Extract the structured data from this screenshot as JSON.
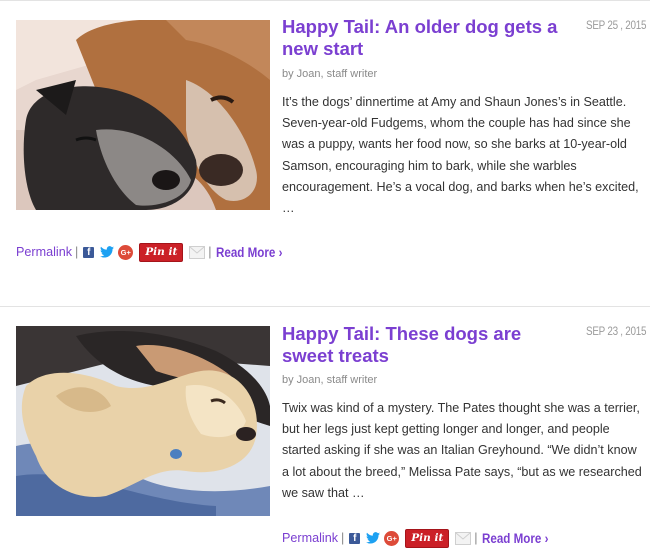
{
  "posts": [
    {
      "title": "Happy Tail: An older dog gets a new start",
      "date": "SEP 25 , 2015",
      "byline": "by Joan, staff writer",
      "excerpt": "It’s the dogs’ dinnertime at Amy and Shaun Jones’s in Seattle. Seven-year-old Fudgems, whom the couple has had since she was a puppy, wants her food now, so she barks at 10-year-old Samson, encouraging him to bark, while she warbles encouragement. He’s a vocal dog, and barks when he’s excited, …",
      "permalink_label": "Permalink",
      "pin_label": "Pin it",
      "read_more_label": "Read More ›",
      "image_icon": "photo-two-dogs-resting"
    },
    {
      "title": "Happy Tail: These dogs are sweet treats",
      "date": "SEP 23 , 2015",
      "byline": "by Joan, staff writer",
      "excerpt": "Twix was kind of a mystery. The Pates thought she was a terrier, but her legs just kept getting longer and longer, and people started asking if she was an Italian Greyhound. “We didn’t know a lot about the breed,” Melissa Pate says, “but as we researched we saw that …",
      "permalink_label": "Permalink",
      "pin_label": "Pin it",
      "read_more_label": "Read More ›",
      "image_icon": "photo-dogs-sleeping-on-blanket"
    }
  ],
  "colors": {
    "accent": "#7b3fd1",
    "text": "#333333",
    "muted": "#8a8a8a",
    "facebook": "#3b5998",
    "twitter": "#1da1f2",
    "google_plus": "#dd4b39",
    "pinterest": "#cb2027"
  }
}
